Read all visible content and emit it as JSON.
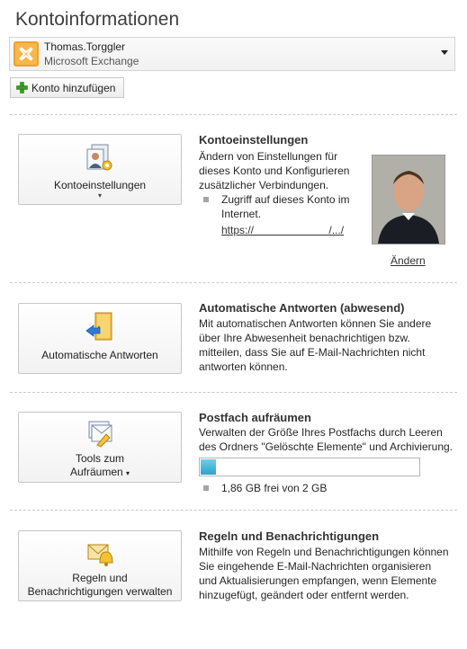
{
  "page": {
    "title": "Kontoinformationen"
  },
  "account": {
    "name": "Thomas.Torggler",
    "type": "Microsoft Exchange",
    "add_account_label": "Konto hinzufügen"
  },
  "sections": {
    "account_settings": {
      "button_label": "Kontoeinstellungen",
      "title": "Kontoeinstellungen",
      "description": "Ändern von Einstellungen für dieses Konto und Konfigurieren zusätzlicher Verbindungen.",
      "bullet_text": "Zugriff auf dieses Konto im Internet.",
      "url": "https://                         /.../",
      "change_photo_label": "Ändern"
    },
    "auto_replies": {
      "button_label": "Automatische Antworten",
      "title": "Automatische Antworten (abwesend)",
      "description": "Mit automatischen Antworten können Sie andere über Ihre Abwesenheit benachrichtigen bzw. mitteilen, dass Sie auf E-Mail-Nachrichten nicht antworten können."
    },
    "cleanup": {
      "button_label_1": "Tools zum",
      "button_label_2": "Aufräumen",
      "title": "Postfach aufräumen",
      "description": "Verwalten der Größe Ihres Postfachs durch Leeren des Ordners \"Gelöschte Elemente\" und Archivierung.",
      "quota_fill_fraction": 0.07,
      "quota_text": "1,86 GB frei von 2 GB"
    },
    "rules": {
      "button_label_1": "Regeln und",
      "button_label_2": "Benachrichtigungen verwalten",
      "title": "Regeln und Benachrichtigungen",
      "description": "Mithilfe von Regeln und Benachrichtigungen können Sie eingehende E-Mail-Nachrichten organisieren und Aktualisierungen empfangen, wenn Elemente hinzugefügt, geändert oder entfernt werden."
    }
  },
  "colors": {
    "progress": "#2ba3c9",
    "add_icon": "#3a9d23"
  }
}
